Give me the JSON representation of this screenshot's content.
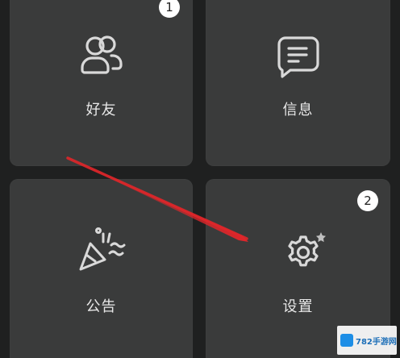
{
  "tiles": {
    "friends": {
      "label": "好友",
      "icon": "users-icon",
      "badge": "1"
    },
    "messages": {
      "label": "信息",
      "icon": "message-icon"
    },
    "notice": {
      "label": "公告",
      "icon": "party-popper-icon"
    },
    "settings": {
      "label": "设置",
      "icon": "gear-icon",
      "badge": "2"
    }
  },
  "annotation": {
    "arrow_color": "#e0262a"
  },
  "watermark": {
    "text": "782手游网"
  },
  "colors": {
    "background": "#1f2020",
    "tile": "#3a3b3b",
    "icon_stroke": "#d9d9d9",
    "label": "#e8e8e8"
  }
}
